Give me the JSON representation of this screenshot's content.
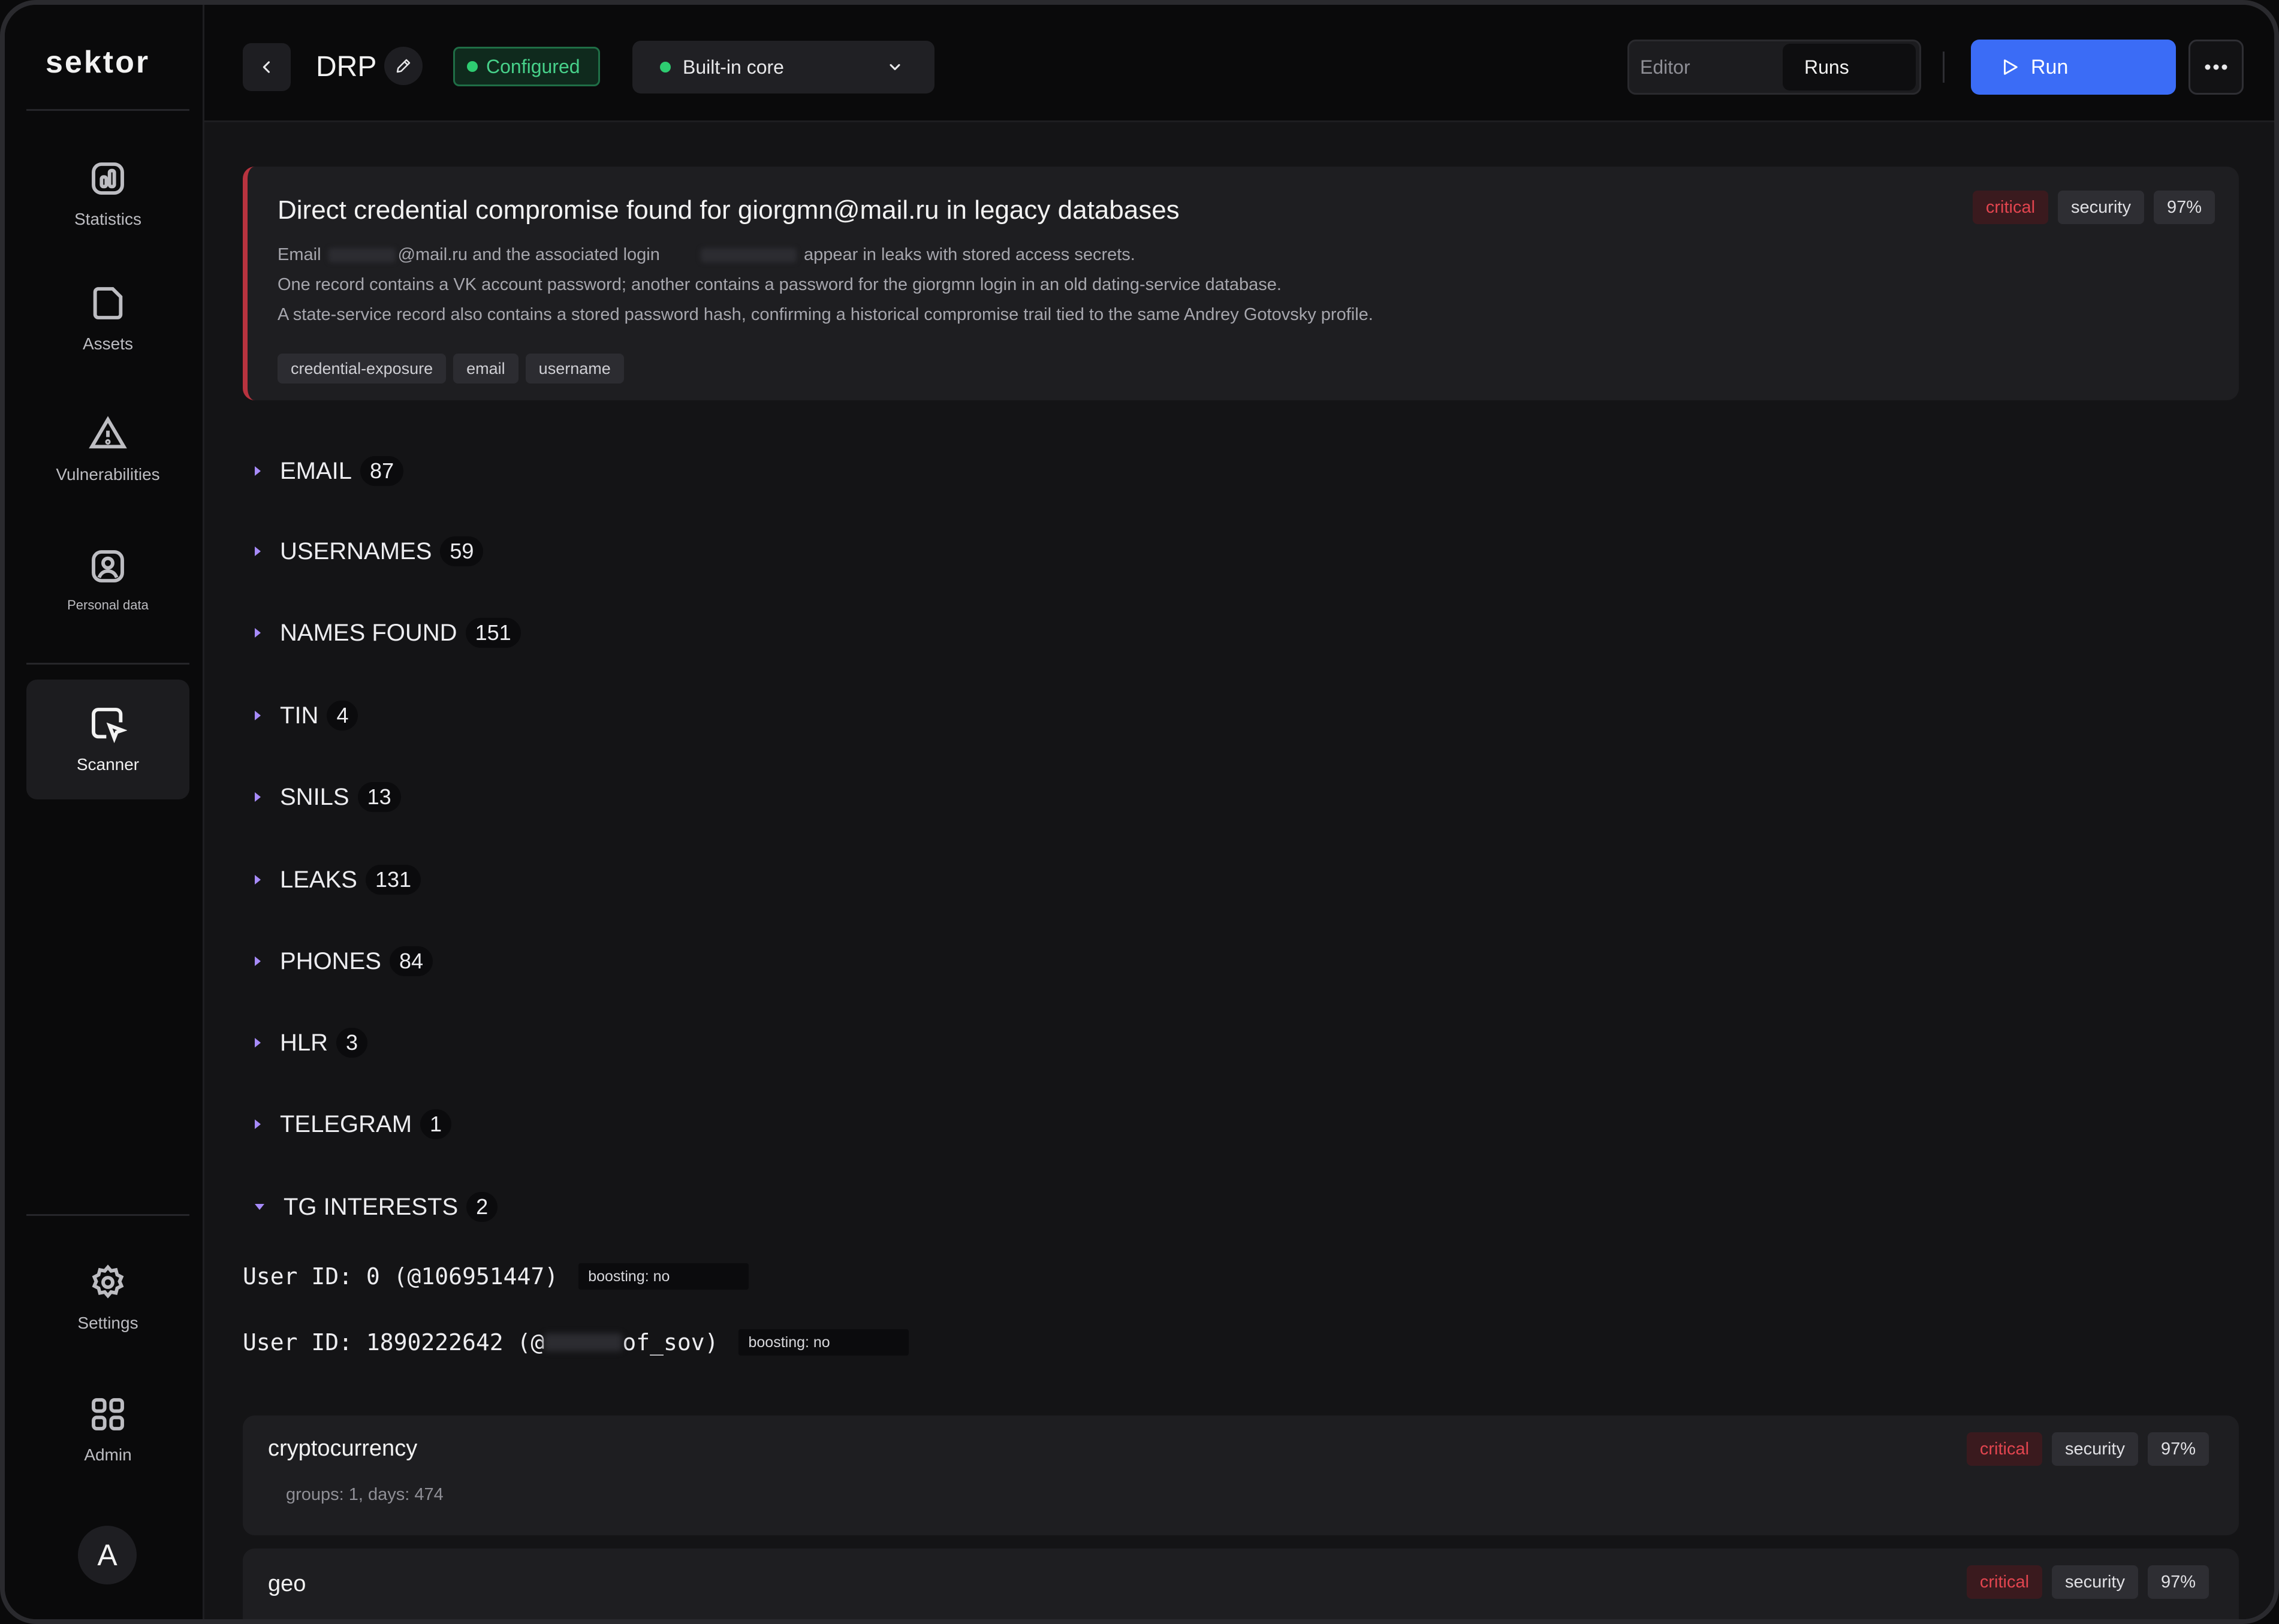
{
  "app": {
    "logo_text": "sektor"
  },
  "sidebar": {
    "items": [
      {
        "label": "Statistics",
        "icon": "chart-icon"
      },
      {
        "label": "Assets",
        "icon": "folder-icon"
      },
      {
        "label": "Vulnerabilities",
        "icon": "warning-icon"
      },
      {
        "label": "Personal data",
        "icon": "person-icon"
      },
      {
        "label": "Scanner",
        "icon": "scanner-icon",
        "active": true
      },
      {
        "label": "Settings",
        "icon": "gear-icon"
      },
      {
        "label": "Admin",
        "icon": "grid-icon"
      }
    ],
    "avatar_initial": "A"
  },
  "topbar": {
    "title": "DRP",
    "status_badge": "Configured",
    "core_select": "Built-in core",
    "tabs": {
      "editor": "Editor",
      "runs": "Runs"
    },
    "run_label": "Run"
  },
  "finding": {
    "title": "Direct credential compromise found for giorgmn@mail.ru in legacy databases",
    "line1_prefix": "Email",
    "line1_mid": "@mail.ru and the associated login",
    "line1_suffix": "appear in leaks with stored access secrets.",
    "line2": "One record contains a VK account password; another contains a password for the giorgmn login in an old dating-service database.",
    "line3": "A state-service record also contains a stored password hash, confirming a historical compromise trail tied to the same Andrey Gotovsky profile.",
    "chips": [
      "credential-exposure",
      "email",
      "username"
    ],
    "tags": {
      "severity": "critical",
      "category": "security",
      "confidence": "97%"
    }
  },
  "sections": [
    {
      "label": "EMAIL",
      "count": "87"
    },
    {
      "label": "USERNAMES",
      "count": "59"
    },
    {
      "label": "NAMES FOUND",
      "count": "151"
    },
    {
      "label": "TIN",
      "count": "4"
    },
    {
      "label": "SNILS",
      "count": "13"
    },
    {
      "label": "LEAKS",
      "count": "131"
    },
    {
      "label": "PHONES",
      "count": "84"
    },
    {
      "label": "HLR",
      "count": "3"
    },
    {
      "label": "TELEGRAM",
      "count": "1"
    },
    {
      "label": "TG INTERESTS",
      "count": "2"
    }
  ],
  "tg_users": [
    {
      "text": "User ID: 0 (@106951447)",
      "boost": "boosting: no"
    },
    {
      "prefix": "User ID: 1890222642 (@",
      "suffix": "of_sov)",
      "boost": "boosting: no"
    }
  ],
  "items": [
    {
      "title": "cryptocurrency",
      "subtitle": "groups: 1, days: 474",
      "severity": "critical",
      "category": "security",
      "confidence": "97%"
    },
    {
      "title": "geo",
      "severity": "critical",
      "category": "security",
      "confidence": "97%"
    }
  ],
  "colors": {
    "accent": "#3b6cf6",
    "critical": "#e2454f",
    "configured": "#47d18a",
    "triangle": "#a78bfa"
  }
}
